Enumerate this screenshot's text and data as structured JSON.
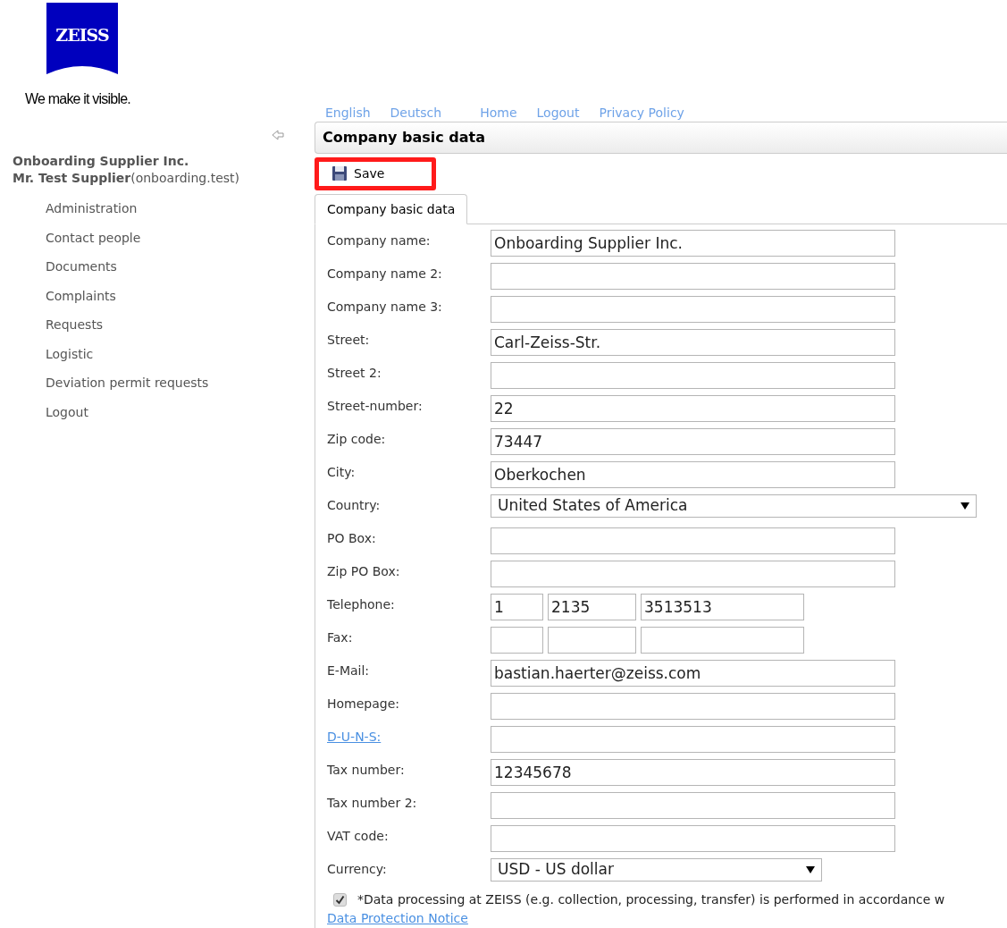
{
  "logo": {
    "text": "ZEISS",
    "tagline": "We make it visible."
  },
  "top_links": [
    "English",
    "Deutsch",
    "Home",
    "Logout",
    "Privacy Policy"
  ],
  "sidebar": {
    "company": "Onboarding Supplier Inc.",
    "user": "Mr. Test Supplier",
    "login": "(onboarding.test)",
    "items": [
      "Administration",
      "Contact people",
      "Documents",
      "Complaints",
      "Requests",
      "Logistic",
      "Deviation permit requests",
      "Logout"
    ]
  },
  "page_title": "Company basic data",
  "toolbar": {
    "save": "Save",
    "highlighted": true
  },
  "tabs": [
    {
      "label": "Company basic data",
      "selected": true
    }
  ],
  "fields": [
    {
      "kind": "text",
      "label": "Company name:",
      "value": "Onboarding Supplier Inc."
    },
    {
      "kind": "text",
      "label": "Company name 2:"
    },
    {
      "kind": "text",
      "label": "Company name 3:"
    },
    {
      "kind": "text",
      "label": "Street:",
      "value": "Carl-Zeiss-Str."
    },
    {
      "kind": "text",
      "label": "Street 2:"
    },
    {
      "kind": "text",
      "label": "Street-number:",
      "value": "22"
    },
    {
      "kind": "text",
      "label": "Zip code:",
      "value": "73447"
    },
    {
      "kind": "text",
      "label": "City:",
      "value": "Oberkochen"
    },
    {
      "kind": "select",
      "label": "Country:",
      "value": "United States of America",
      "wide": true
    },
    {
      "kind": "text",
      "label": "PO Box:"
    },
    {
      "kind": "text",
      "label": "Zip PO Box:"
    },
    {
      "kind": "phone",
      "label": "Telephone:",
      "parts": [
        {
          "value": "1"
        },
        {
          "value": "2135"
        },
        {
          "value": "3513513"
        }
      ]
    },
    {
      "kind": "phone",
      "label": "Fax:"
    },
    {
      "kind": "text",
      "label": "E-Mail:",
      "value": "bastian.haerter@zeiss.com"
    },
    {
      "kind": "text",
      "label": "Homepage:"
    },
    {
      "kind": "text",
      "label": "D-U-N-S:",
      "link": true
    },
    {
      "kind": "text",
      "label": "Tax number:",
      "value": "12345678"
    },
    {
      "kind": "text",
      "label": "Tax number 2:"
    },
    {
      "kind": "text",
      "label": "VAT code:"
    },
    {
      "kind": "select",
      "label": "Currency:",
      "value": "USD - US dollar",
      "wide": false
    }
  ],
  "consent": {
    "checked": true,
    "text": "*Data processing at ZEISS (e.g. collection, processing, transfer) is performed in accordance w",
    "link": "Data Protection Notice"
  }
}
